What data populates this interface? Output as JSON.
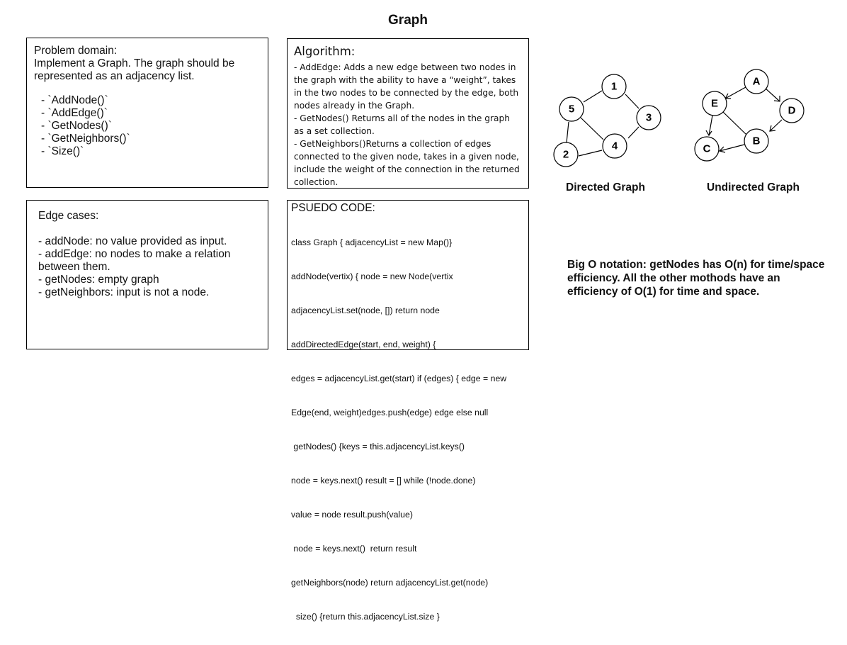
{
  "title": "Graph",
  "problem": {
    "heading": "Problem domain:",
    "description": "Implement a Graph. The graph should be represented as an adjacency list.",
    "methods": [
      "- `AddNode()`",
      "- `AddEdge()`",
      "- `GetNodes()`",
      "- `GetNeighbors()`",
      "- `Size()`"
    ]
  },
  "algorithm": {
    "heading": "Algorithm:",
    "items": [
      "- AddEdge: Adds a new edge between two nodes in the graph with the ability to have a “weight”, takes in the two nodes to be connected by the edge, both nodes already in the Graph.",
      "- GetNodes() Returns all of the nodes in the graph as a set collection.",
      "- GetNeighbors()Returns a collection of edges connected to the given node, takes in a given node, include the weight of the connection in the returned collection."
    ]
  },
  "edge_cases": {
    "heading": "Edge cases:",
    "items": [
      "- addNode: no value provided as input.",
      "- addEdge: no nodes to make a relation between them.",
      "- getNodes: empty graph",
      "- getNeighbors: input is not a node."
    ]
  },
  "pseudo": {
    "heading": "PSUEDO CODE:",
    "lines": [
      "class Graph { adjacencyList = new Map()}",
      "addNode(vertix) { node = new Node(vertix",
      "adjacencyList.set(node, []) return node",
      "addDirectedEdge(start, end, weight) {",
      "edges = adjacencyList.get(start) if (edges) { edge = new",
      "Edge(end, weight)edges.push(edge) edge else null",
      " getNodes() {keys = this.adjacencyList.keys()",
      "node = keys.next() result = [] while (!node.done)",
      "value = node result.push(value)",
      " node = keys.next()  return result",
      "getNeighbors(node) return adjacencyList.get(node)",
      "  size() {return this.adjacencyList.size }"
    ]
  },
  "directed_graph": {
    "label": "Directed Graph",
    "nodes": [
      "1",
      "2",
      "3",
      "4",
      "5"
    ],
    "edges": [
      [
        "5",
        "1"
      ],
      [
        "1",
        "3"
      ],
      [
        "3",
        "4"
      ],
      [
        "5",
        "4"
      ],
      [
        "5",
        "2"
      ],
      [
        "2",
        "4"
      ]
    ]
  },
  "undirected_graph": {
    "label": "Undirected Graph",
    "nodes": [
      "A",
      "B",
      "C",
      "D",
      "E"
    ],
    "edges": [
      [
        "A",
        "E"
      ],
      [
        "A",
        "D"
      ],
      [
        "D",
        "B"
      ],
      [
        "E",
        "B"
      ],
      [
        "E",
        "C"
      ],
      [
        "B",
        "C"
      ]
    ]
  },
  "big_o": "Big O notation: getNodes has O(n) for time/space efficiency. All the other mothods have an efficiency of O(1) for time and space."
}
